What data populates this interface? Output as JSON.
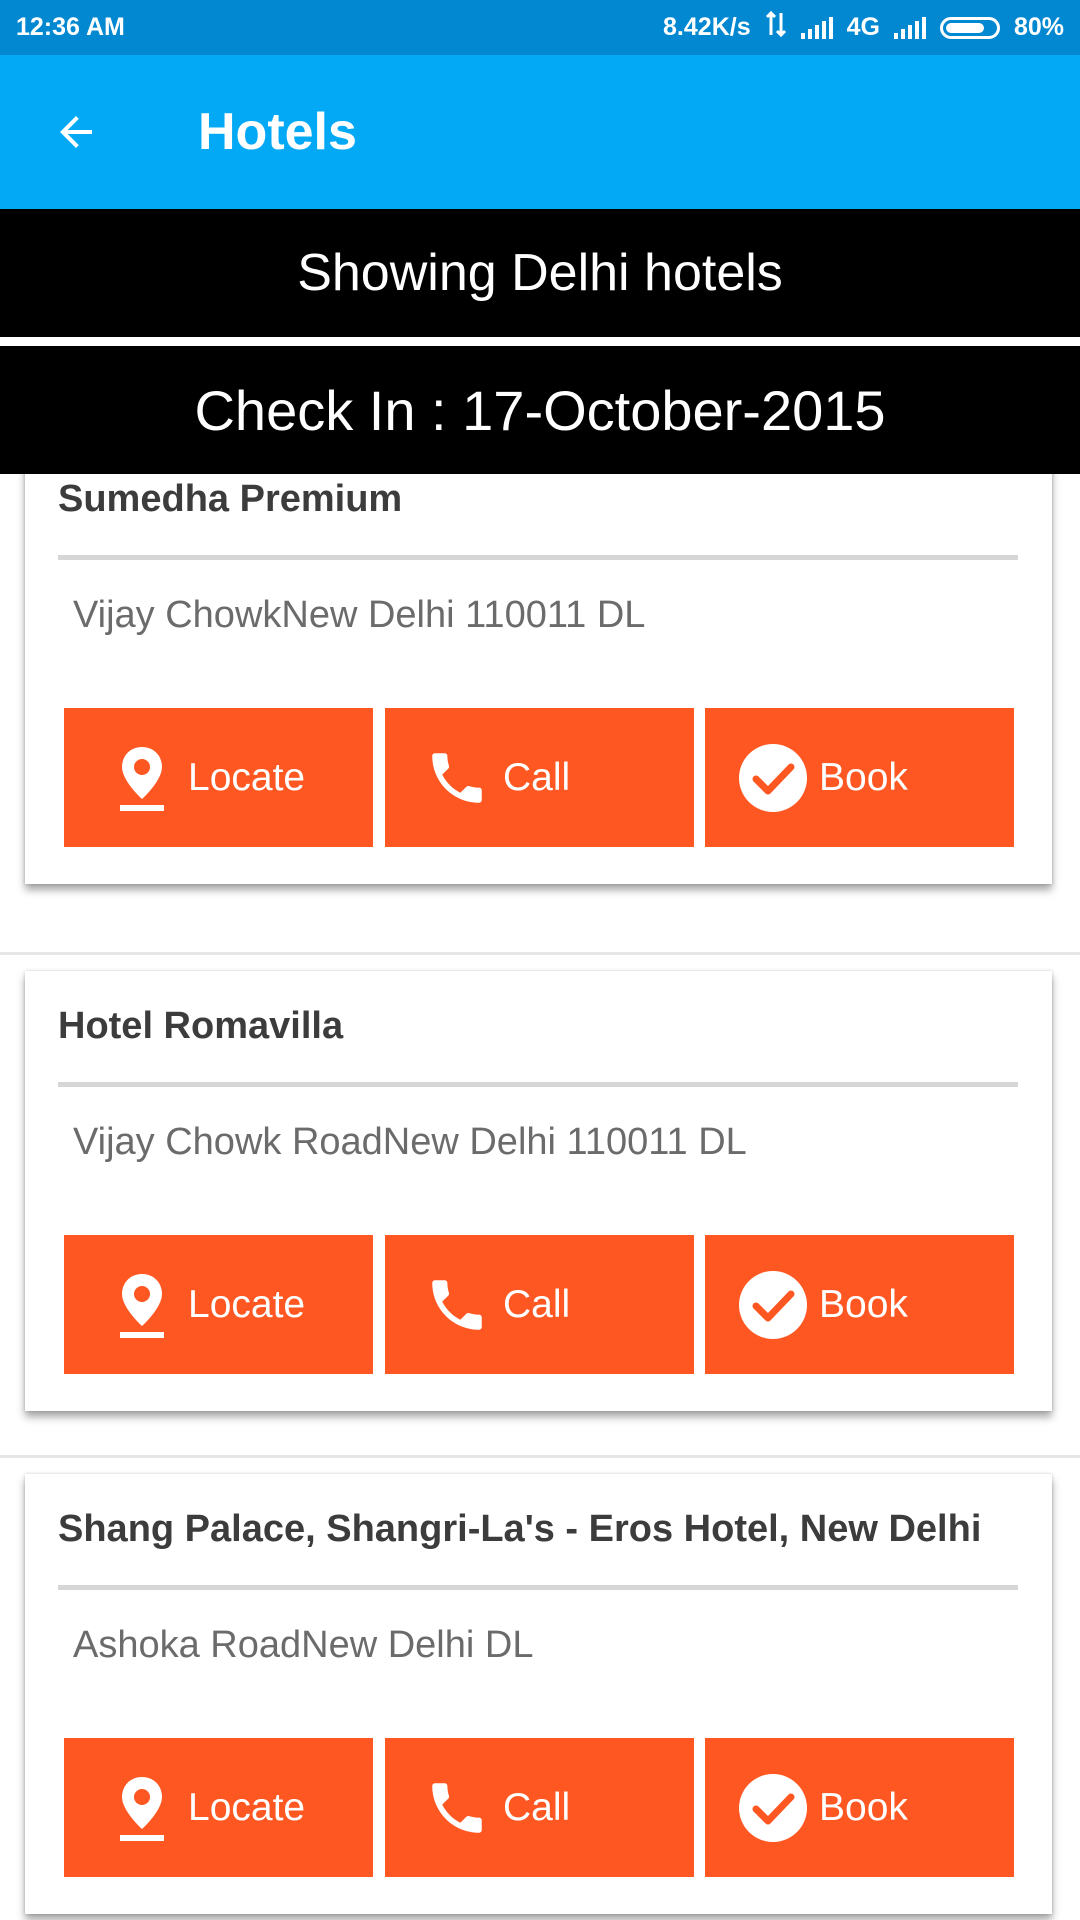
{
  "status_bar": {
    "time": "12:36 AM",
    "net_speed": "8.42K/s",
    "network_type": "4G",
    "battery": "80%",
    "battery_level": 0.8
  },
  "app_bar": {
    "title": "Hotels",
    "back_icon": "arrow-left-icon"
  },
  "banners": {
    "city": "Showing Delhi hotels",
    "check_in": "Check In : 17-October-2015"
  },
  "hotels": [
    {
      "name": "Sumedha Premium",
      "address": "Vijay ChowkNew Delhi 110011 DL"
    },
    {
      "name": "Hotel Romavilla",
      "address": "Vijay Chowk RoadNew Delhi 110011 DL"
    },
    {
      "name": "Shang Palace, Shangri-La's - Eros Hotel, New Delhi",
      "address": "Ashoka RoadNew Delhi DL"
    }
  ],
  "actions": {
    "locate": "Locate",
    "call": "Call",
    "book": "Book"
  },
  "colors": {
    "status_bar": "#0288d1",
    "app_bar": "#03a9f4",
    "button": "#ff5722",
    "banner": "#000000"
  }
}
